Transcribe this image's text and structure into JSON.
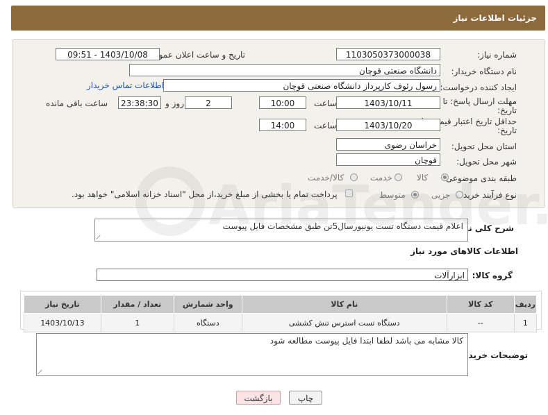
{
  "header": {
    "title": "جزئیات اطلاعات نیاز"
  },
  "form": {
    "need_number_label": "شماره نیاز:",
    "need_number": "1103050373000038",
    "announce_label": "تاریخ و ساعت اعلان عمومی:",
    "announce_value": "1403/10/08 - 09:51",
    "buyer_org_label": "نام دستگاه خریدار:",
    "buyer_org": "دانشگاه صنعتی قوچان",
    "creator_label": "ایجاد کننده درخواست:",
    "creator": "رسول رئوف کارپرداز دانشگاه صنعتی قوچان",
    "contact_link": "اطلاعات تماس خریدار",
    "deadline_label_1": "مهلت ارسال پاسخ: تا",
    "deadline_label_2": "تاریخ:",
    "deadline_date": "1403/10/11",
    "time_label": "ساعت",
    "deadline_time": "10:00",
    "days_value": "2",
    "days_label": "روز و",
    "remaining_time": "23:38:30",
    "remaining_label": "ساعت باقی مانده",
    "validity_label_1": "حداقل تاریخ اعتبار قیمت: تا",
    "validity_label_2": "تاریخ:",
    "validity_date": "1403/10/20",
    "validity_time": "14:00",
    "province_label": "استان محل تحویل:",
    "province": "خراسان رضوی",
    "city_label": "شهر محل تحویل:",
    "city": "قوچان",
    "category_label": "طبقه بندی موضوعی:",
    "category_options": [
      "کالا",
      "خدمت",
      "کالا/خدمت"
    ],
    "category_selected": "کالا",
    "process_label": "نوع فرآیند خرید :",
    "process_options": [
      "جزیی",
      "متوسط"
    ],
    "process_selected": "متوسط",
    "payment_note": "پرداخت تمام یا بخشی از مبلغ خرید،از محل \"اسناد خزانه اسلامی\" خواهد بود."
  },
  "summary": {
    "label": "شرح کلی نیاز:",
    "text": "اعلام قیمت دستگاه تست یونیورسال5تن طبق مشخصات فایل پیوست"
  },
  "goods": {
    "section_title": "اطلاعات کالاهای مورد نیاز",
    "group_label": "گروه کالا:",
    "group_value": "ابزارآلات"
  },
  "table": {
    "headers": [
      "ردیف",
      "کد کالا",
      "نام کالا",
      "واحد شمارش",
      "تعداد / مقدار",
      "تاریخ نیاز"
    ],
    "rows": [
      [
        "1",
        "--",
        "دستگاه تست استرس تنش کششی",
        "دستگاه",
        "1",
        "1403/10/13"
      ]
    ]
  },
  "buyer_notes": {
    "label": "توضیحات خریدار:",
    "text": "کالا مشابه می باشد لطفا ابتدا فایل پیوست مطالعه شود"
  },
  "buttons": {
    "print": "چاپ",
    "back": "بازگشت"
  },
  "colors": {
    "header_bg": "#8c6a3c",
    "panel_bg": "#f3f1ec",
    "table_head": "#c9c9c9",
    "link": "#1a55b0"
  },
  "watermark_text": "AriaTender.net"
}
